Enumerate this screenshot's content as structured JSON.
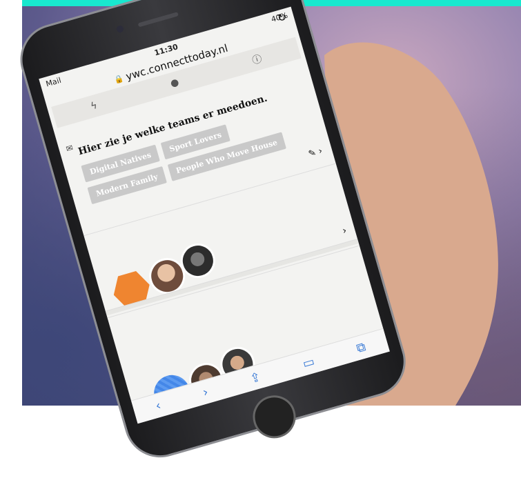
{
  "status": {
    "carrier": "Mail",
    "time": "11:30",
    "battery": "40%"
  },
  "browser": {
    "url": "ywc.connecttoday.nl"
  },
  "page": {
    "heading": "Hier zie je welke teams er meedoen.",
    "teams": [
      "Digital Natives",
      "Sport Lovers",
      "Modern Family",
      "People Who Move House"
    ]
  },
  "colors": {
    "accent_bar": "#18e8cf",
    "orange_hex": "#ef8530",
    "blue_circle": "#4487e8"
  }
}
